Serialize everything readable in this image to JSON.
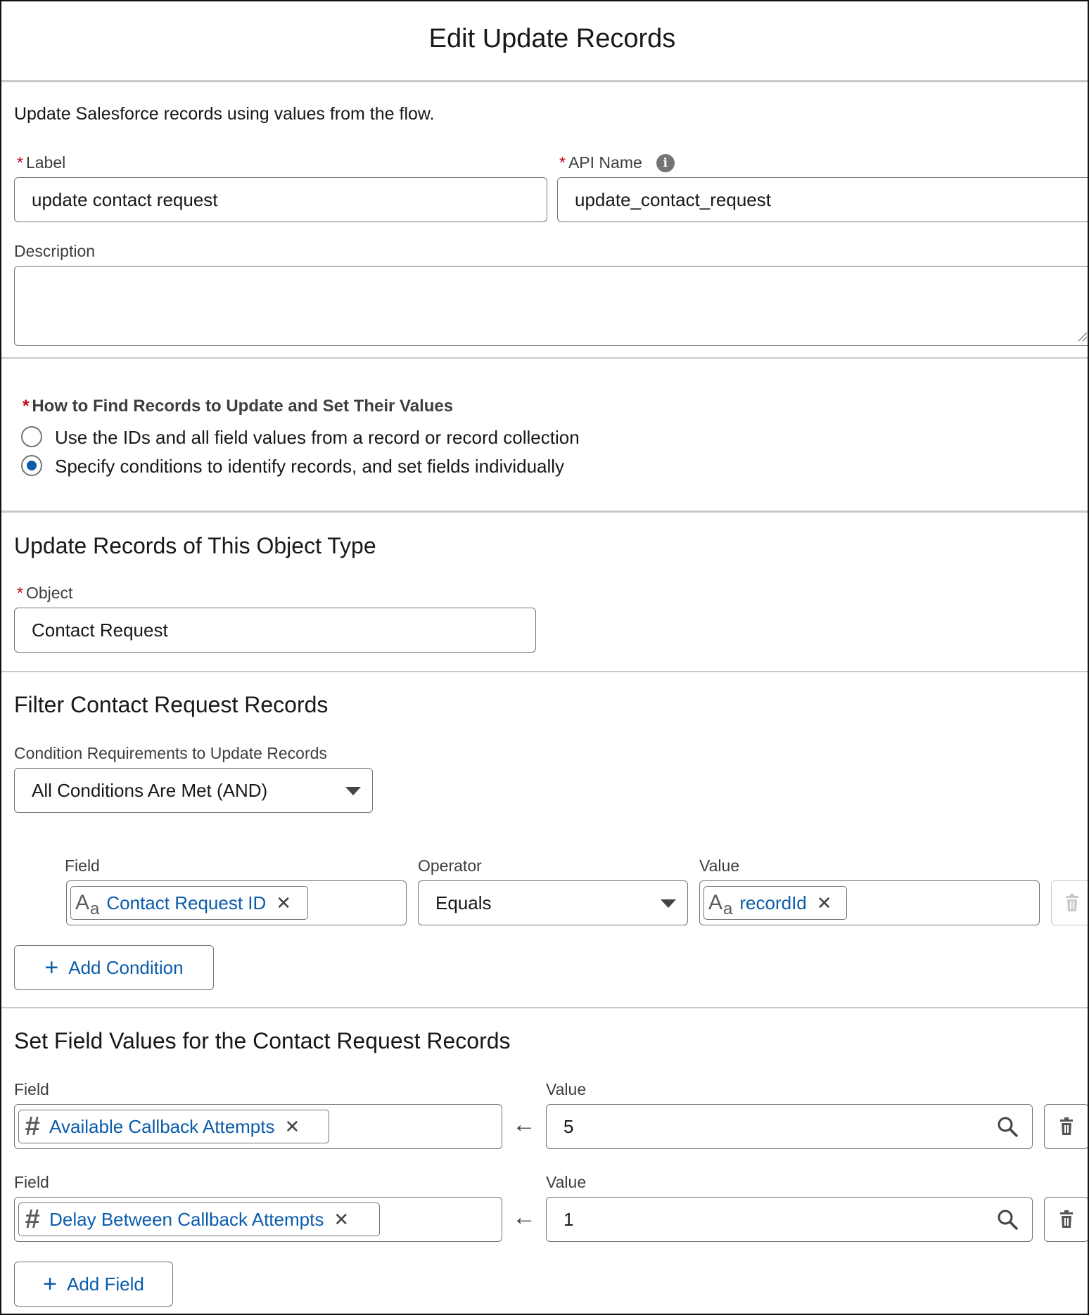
{
  "dialog": {
    "title": "Edit Update Records",
    "description_text": "Update Salesforce records using values from the flow."
  },
  "fields": {
    "label": {
      "label": "Label",
      "value": "update contact request"
    },
    "api_name": {
      "label": "API Name",
      "value": "update_contact_request"
    },
    "description": {
      "label": "Description",
      "value": ""
    }
  },
  "find_records": {
    "label": "How to Find Records to Update and Set Their Values",
    "options": [
      {
        "text": "Use the IDs and all field values from a record or record collection",
        "selected": false
      },
      {
        "text": "Specify conditions to identify records, and set fields individually",
        "selected": true
      }
    ]
  },
  "object_section": {
    "heading": "Update Records of This Object Type",
    "object_label": "Object",
    "object_value": "Contact Request"
  },
  "filter_section": {
    "heading": "Filter Contact Request Records",
    "condition_label": "Condition Requirements to Update Records",
    "condition_value": "All Conditions Are Met (AND)",
    "field_header": "Field",
    "operator_header": "Operator",
    "value_header": "Value",
    "condition": {
      "field": "Contact Request ID",
      "operator": "Equals",
      "value": "recordId"
    },
    "add_condition": "Add Condition"
  },
  "set_values_section": {
    "heading": "Set Field Values for the Contact Request Records",
    "rows": [
      {
        "field_label": "Field",
        "field": "Available Callback Attempts",
        "value_label": "Value",
        "value": "5"
      },
      {
        "field_label": "Field",
        "field": "Delay Between Callback Attempts",
        "value_label": "Value",
        "value": "1"
      }
    ],
    "add_field": "Add Field"
  },
  "icons": {
    "text_type": "text-type-icon",
    "number_type": "number-type-icon",
    "info": "info-icon",
    "delete": "trash-icon",
    "search": "search-icon",
    "clear": "close-icon",
    "assign": "arrow-left-icon",
    "dropdown": "chevron-down-icon",
    "add": "plus-icon"
  },
  "colors": {
    "link_blue": "#0b5cab",
    "required_red": "#ba0517",
    "border_gray": "#747474"
  }
}
